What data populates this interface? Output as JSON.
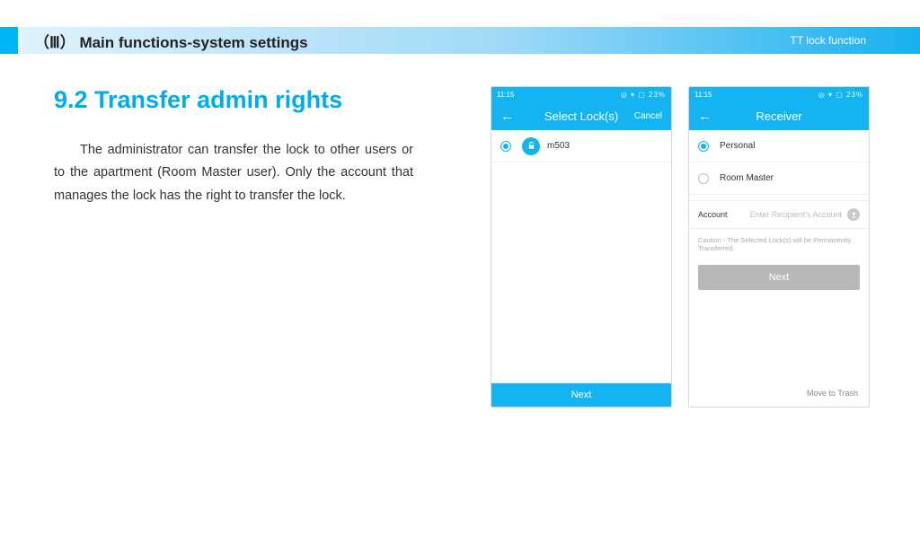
{
  "header": {
    "section": "（Ⅲ）  Main functions-system settings",
    "right": "TT lock function"
  },
  "article": {
    "heading": "9.2 Transfer admin rights",
    "body": "The administrator can transfer the lock to other users or to the apartment (Room Master user). Only the account that manages the lock has the right to transfer the lock."
  },
  "status": {
    "time": "11:15",
    "right": "◎ ▾ ▢ 23%"
  },
  "phone1": {
    "title": "Select Lock(s)",
    "cancel": "Cancel",
    "lock_name": "m503",
    "next": "Next"
  },
  "phone2": {
    "title": "Receiver",
    "opt_personal": "Personal",
    "opt_roommaster": "Room Master",
    "account_label": "Account",
    "account_placeholder": "Enter Recipient's Account",
    "caution": "Caution - The Selected Lock(s) will be Permanently Transferred.",
    "next": "Next",
    "trash": "Move to Trash"
  }
}
